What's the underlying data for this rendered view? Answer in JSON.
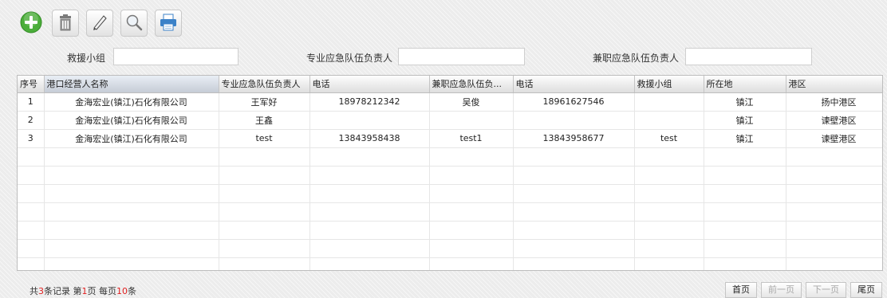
{
  "toolbar": {
    "icons": [
      "add-icon",
      "delete-icon",
      "edit-icon",
      "search-icon",
      "print-icon"
    ],
    "accent": "#4cae3b"
  },
  "filters": {
    "rescue_group_label": "救援小组",
    "rescue_group_value": "",
    "pro_team_leader_label": "专业应急队伍负责人",
    "pro_team_leader_value": "",
    "part_team_leader_label": "兼职应急队伍负责人",
    "part_team_leader_value": ""
  },
  "table": {
    "columns": [
      "序号",
      "港口经营人名称",
      "专业应急队伍负责人",
      "电话",
      "兼职应急队伍负...",
      "电话",
      "救援小组",
      "所在地",
      "港区"
    ],
    "rows": [
      [
        "1",
        "金海宏业(镇江)石化有限公司",
        "王军好",
        "18978212342",
        "吴俊",
        "18961627546",
        "",
        "镇江",
        "扬中港区"
      ],
      [
        "2",
        "金海宏业(镇江)石化有限公司",
        "王鑫",
        "",
        "",
        "",
        "",
        "镇江",
        "谏壁港区"
      ],
      [
        "3",
        "金海宏业(镇江)石化有限公司",
        "test",
        "13843958438",
        "test1",
        "13843958677",
        "test",
        "镇江",
        "谏壁港区"
      ]
    ],
    "empty_rows": 7
  },
  "footer": {
    "total_prefix": "共",
    "total_count": "3",
    "total_suffix": "条记录 第",
    "page_number": "1",
    "page_suffix": "页 每页",
    "page_size": "10",
    "size_suffix": "条",
    "first": "首页",
    "prev": "前一页",
    "next": "下一页",
    "last": "尾页"
  }
}
